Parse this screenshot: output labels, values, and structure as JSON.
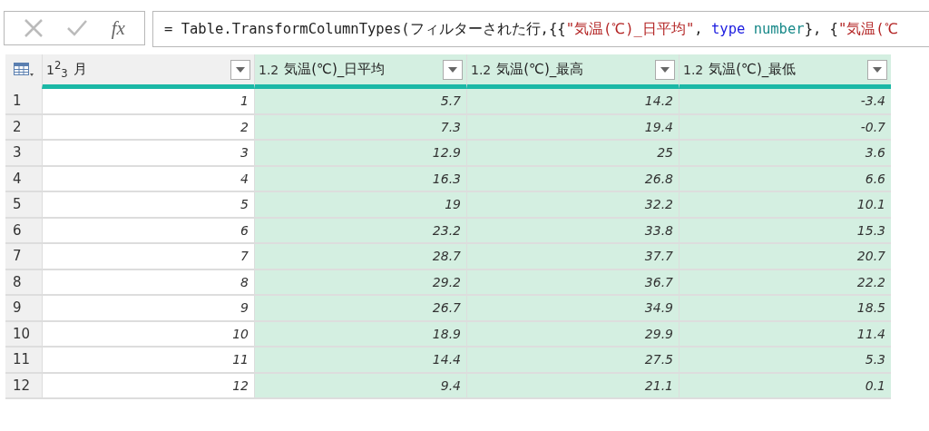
{
  "formula_bar": {
    "fx_label": "fx",
    "formula": [
      {
        "kind": "plain",
        "text": "= Table.TransformColumnTypes(フィルターされた行,{{"
      },
      {
        "kind": "string",
        "text": "\"気温(℃)_日平均\""
      },
      {
        "kind": "plain",
        "text": ", "
      },
      {
        "kind": "keyword",
        "text": "type"
      },
      {
        "kind": "type",
        "text": " number"
      },
      {
        "kind": "plain",
        "text": "}, {"
      },
      {
        "kind": "string",
        "text": "\"気温(℃"
      }
    ]
  },
  "table": {
    "columns": [
      {
        "type_label": "1$^{2}$$_{3}$",
        "name": "月",
        "selected": false
      },
      {
        "type_label": "1.2",
        "name": "気温(℃)_日平均",
        "selected": true
      },
      {
        "type_label": "1.2",
        "name": "気温(℃)_最高",
        "selected": true
      },
      {
        "type_label": "1.2",
        "name": "気温(℃)_最低",
        "selected": true
      }
    ],
    "rows": [
      {
        "row_number": "1",
        "cells": [
          "1",
          "5.7",
          "14.2",
          "-3.4"
        ]
      },
      {
        "row_number": "2",
        "cells": [
          "2",
          "7.3",
          "19.4",
          "-0.7"
        ]
      },
      {
        "row_number": "3",
        "cells": [
          "3",
          "12.9",
          "25",
          "3.6"
        ]
      },
      {
        "row_number": "4",
        "cells": [
          "4",
          "16.3",
          "26.8",
          "6.6"
        ]
      },
      {
        "row_number": "5",
        "cells": [
          "5",
          "19",
          "32.2",
          "10.1"
        ]
      },
      {
        "row_number": "6",
        "cells": [
          "6",
          "23.2",
          "33.8",
          "15.3"
        ]
      },
      {
        "row_number": "7",
        "cells": [
          "7",
          "28.7",
          "37.7",
          "20.7"
        ]
      },
      {
        "row_number": "8",
        "cells": [
          "8",
          "29.2",
          "36.7",
          "22.2"
        ]
      },
      {
        "row_number": "9",
        "cells": [
          "9",
          "26.7",
          "34.9",
          "18.5"
        ]
      },
      {
        "row_number": "10",
        "cells": [
          "10",
          "18.9",
          "29.9",
          "11.4"
        ]
      },
      {
        "row_number": "11",
        "cells": [
          "11",
          "14.4",
          "27.5",
          "5.3"
        ]
      },
      {
        "row_number": "12",
        "cells": [
          "12",
          "9.4",
          "21.1",
          "0.1"
        ]
      }
    ]
  }
}
